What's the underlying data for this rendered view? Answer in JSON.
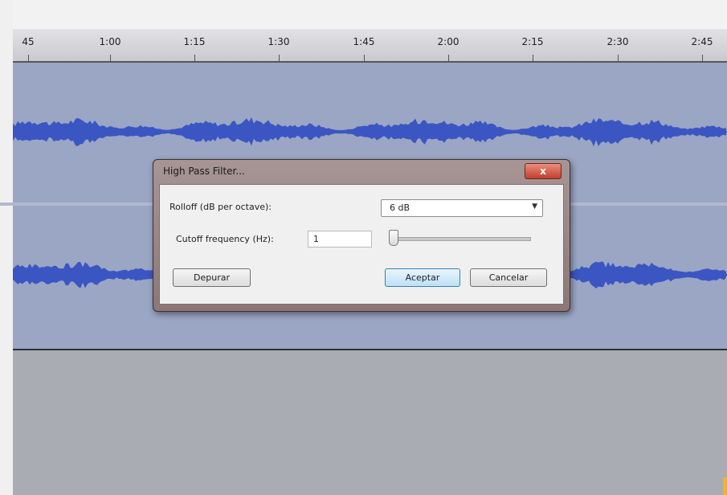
{
  "ruler": {
    "ticks": [
      "45",
      "1:00",
      "1:15",
      "1:30",
      "1:45",
      "2:00",
      "2:15",
      "2:30",
      "2:45"
    ]
  },
  "dialog": {
    "title": "High Pass Filter...",
    "close_label": "x",
    "rolloff_label": "Rolloff (dB per octave):",
    "rolloff_value": "6 dB",
    "cutoff_label": "Cutoff frequency (Hz):",
    "cutoff_value": "1",
    "slider_level": 0,
    "buttons": {
      "debug": "Depurar",
      "ok": "Aceptar",
      "cancel": "Cancelar"
    }
  },
  "colors": {
    "waveform": "#3b56c2",
    "track_bg": "#9aa6c4",
    "close_button": "#c74a36",
    "accent_mark": "#f3b51c"
  }
}
